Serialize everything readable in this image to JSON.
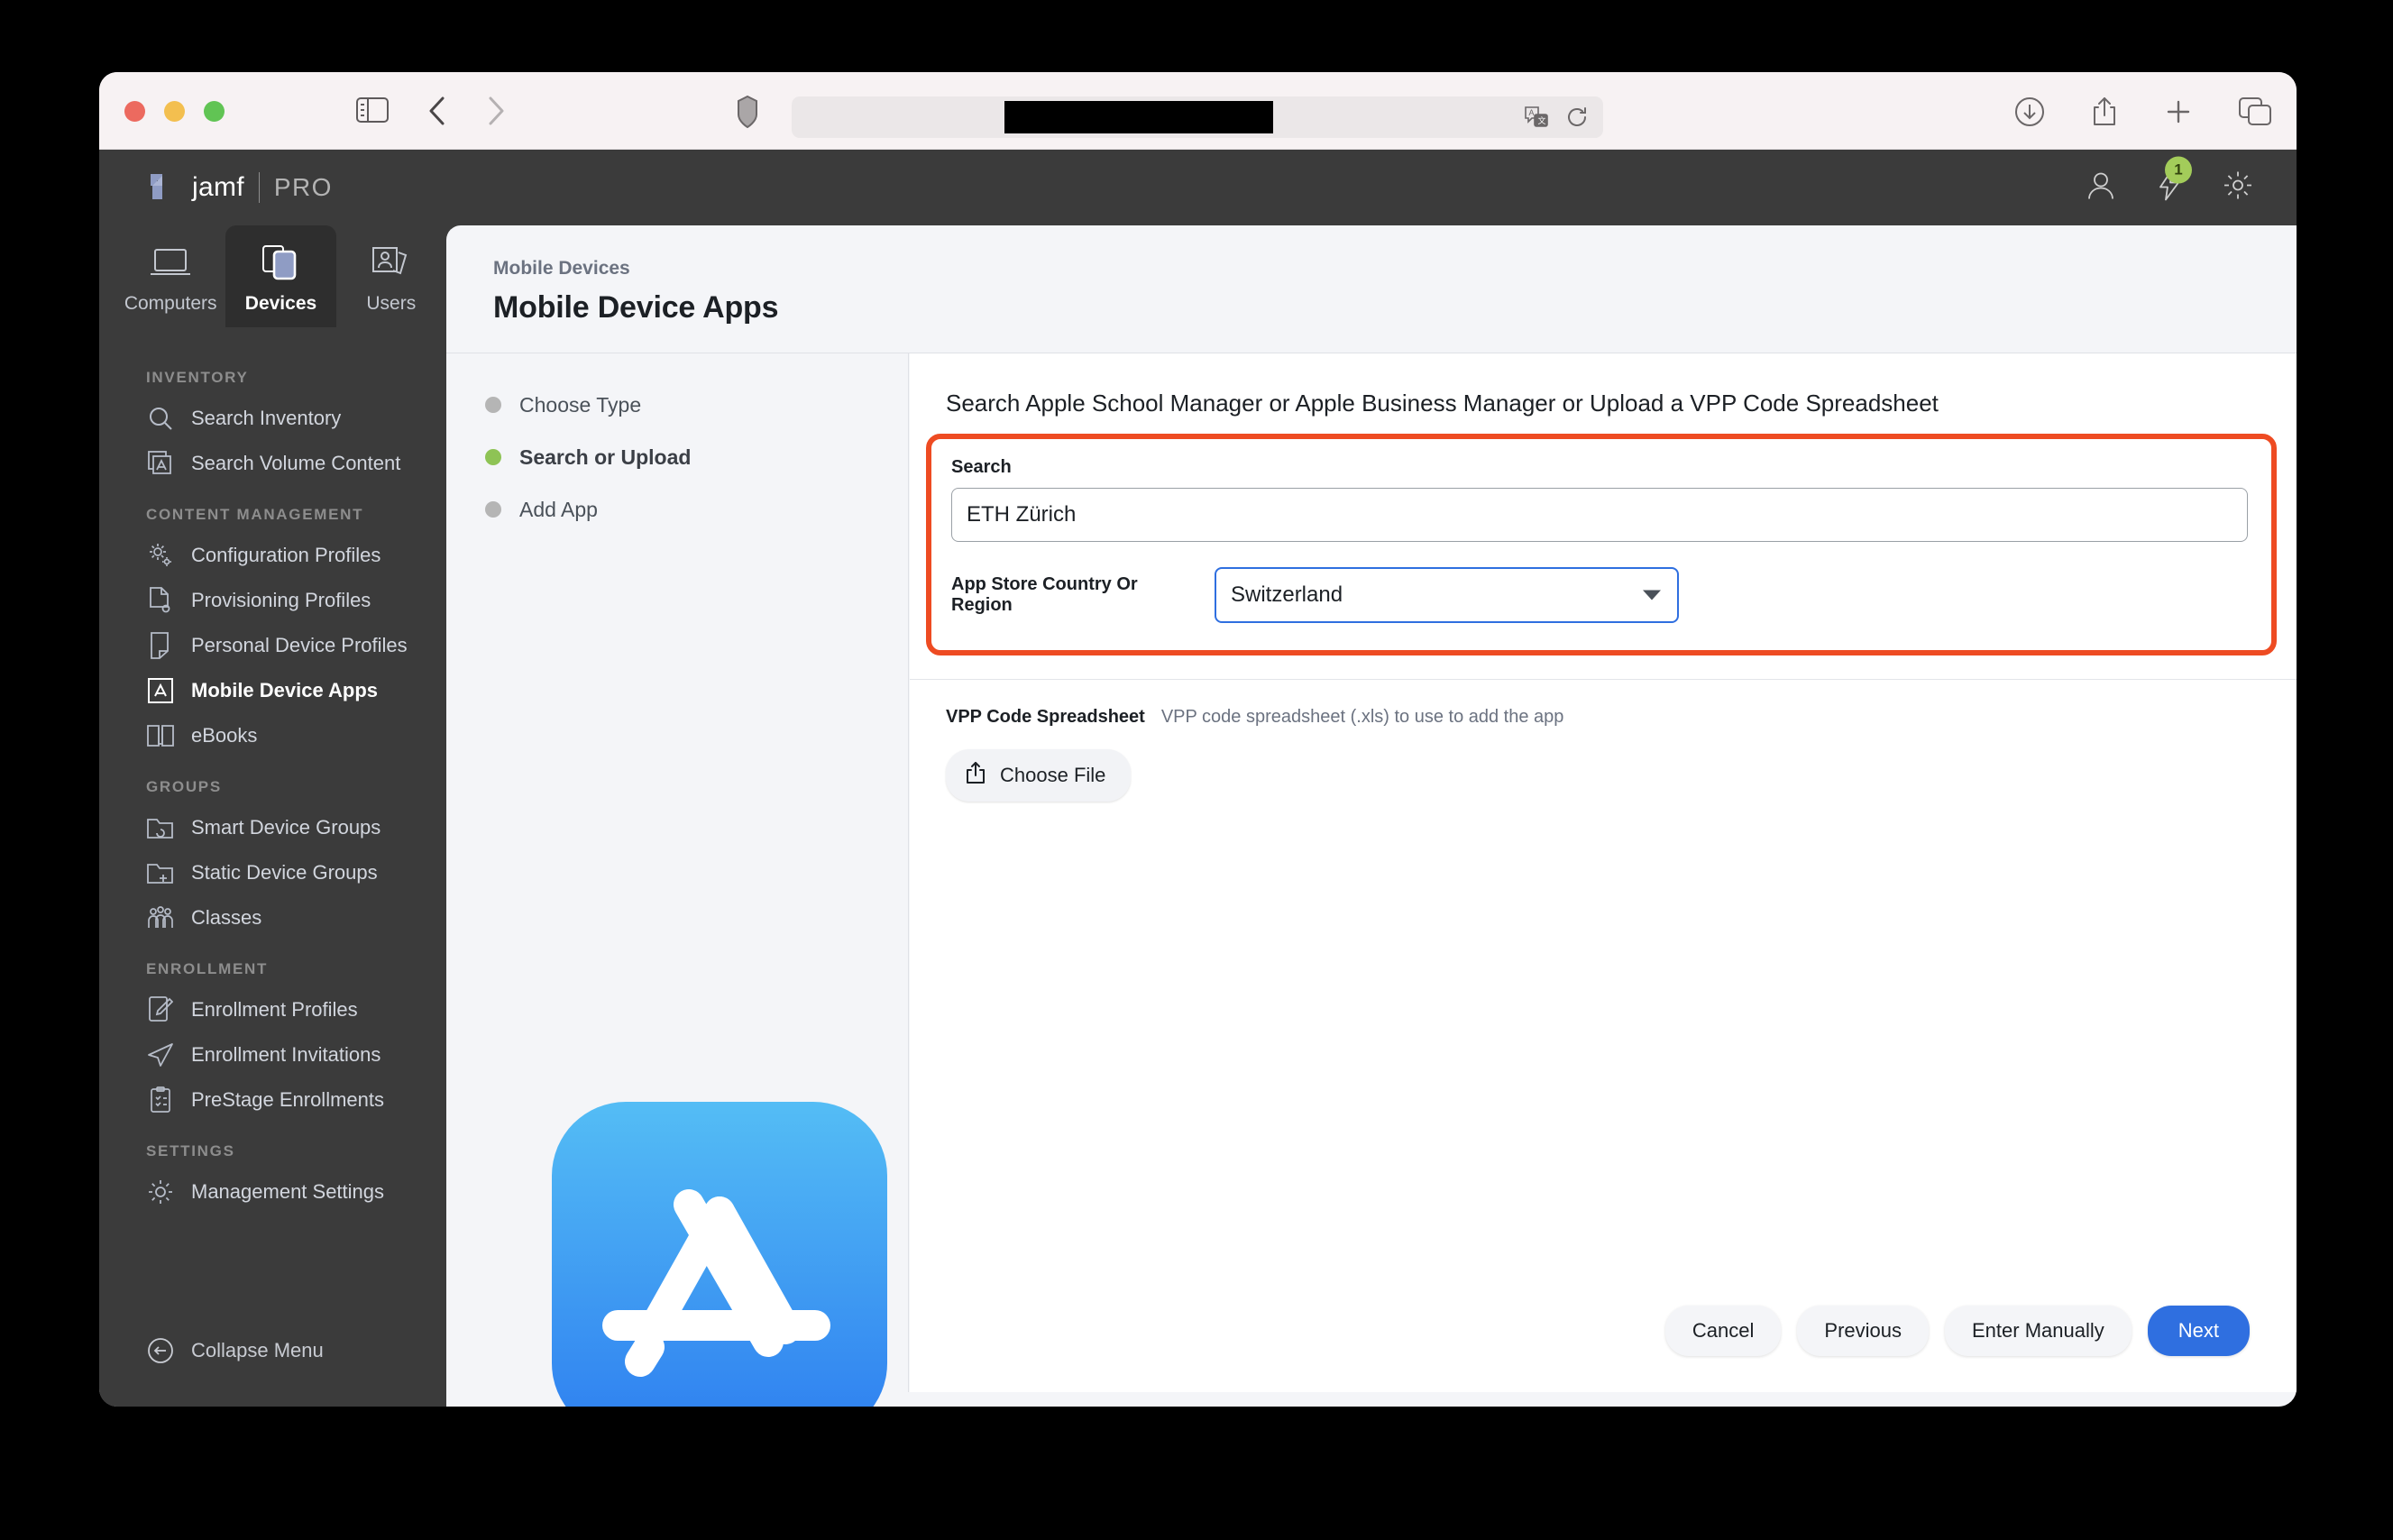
{
  "browser": {
    "traffic_lights": [
      "close",
      "minimize",
      "maximize"
    ],
    "url_value": "",
    "icons": {
      "sidebar": "sidebar-toggle-icon",
      "back": "back-arrow-icon",
      "forward": "forward-arrow-icon",
      "shield": "privacy-shield-icon",
      "translate": "translate-icon",
      "reload": "reload-icon",
      "downloads": "downloads-icon",
      "share": "share-icon",
      "new_tab": "plus-icon",
      "tab_overview": "tab-overview-icon"
    }
  },
  "app_header": {
    "logo_text": "jamf",
    "logo_pro": "PRO",
    "notification_count": "1",
    "icons": {
      "user": "user-icon",
      "notifications": "lightning-bolt-icon",
      "settings": "gear-icon"
    }
  },
  "tabs": [
    {
      "label": "Computers",
      "icon": "laptop-icon",
      "active": false
    },
    {
      "label": "Devices",
      "icon": "mobile-device-icon",
      "active": true
    },
    {
      "label": "Users",
      "icon": "users-icon",
      "active": false
    }
  ],
  "sidebar": {
    "sections": [
      {
        "label": "INVENTORY",
        "items": [
          {
            "label": "Search Inventory",
            "icon": "magnifier-icon",
            "active": false
          },
          {
            "label": "Search Volume Content",
            "icon": "app-store-stack-icon",
            "active": false
          }
        ]
      },
      {
        "label": "CONTENT MANAGEMENT",
        "items": [
          {
            "label": "Configuration Profiles",
            "icon": "gears-icon",
            "active": false
          },
          {
            "label": "Provisioning Profiles",
            "icon": "document-gear-icon",
            "active": false
          },
          {
            "label": "Personal Device Profiles",
            "icon": "personal-device-icon",
            "active": false
          },
          {
            "label": "Mobile Device Apps",
            "icon": "app-store-icon",
            "active": true
          },
          {
            "label": "eBooks",
            "icon": "book-icon",
            "active": false
          }
        ]
      },
      {
        "label": "GROUPS",
        "items": [
          {
            "label": "Smart Device Groups",
            "icon": "folder-sync-icon",
            "active": false
          },
          {
            "label": "Static Device Groups",
            "icon": "folder-plus-icon",
            "active": false
          },
          {
            "label": "Classes",
            "icon": "people-group-icon",
            "active": false
          }
        ]
      },
      {
        "label": "ENROLLMENT",
        "items": [
          {
            "label": "Enrollment Profiles",
            "icon": "device-pencil-icon",
            "active": false
          },
          {
            "label": "Enrollment Invitations",
            "icon": "paper-plane-icon",
            "active": false
          },
          {
            "label": "PreStage Enrollments",
            "icon": "clipboard-check-icon",
            "active": false
          }
        ]
      },
      {
        "label": "SETTINGS",
        "items": [
          {
            "label": "Management Settings",
            "icon": "gear-icon",
            "active": false
          }
        ]
      }
    ],
    "collapse_label": "Collapse Menu",
    "collapse_icon": "arrow-left-circle-icon"
  },
  "page": {
    "breadcrumb": "Mobile Devices",
    "title": "Mobile Device Apps"
  },
  "wizard": {
    "steps": [
      {
        "label": "Choose Type",
        "active": false
      },
      {
        "label": "Search or Upload",
        "active": true
      },
      {
        "label": "Add App",
        "active": false
      }
    ],
    "illustration_icon": "app-store-large-icon"
  },
  "form": {
    "title": "Search Apple School Manager or Apple Business Manager or Upload a VPP Code Spreadsheet",
    "search_label": "Search",
    "search_value": "ETH Zürich",
    "search_placeholder": "",
    "country_label": "App Store Country Or Region",
    "country_value": "Switzerland",
    "vpp_label": "VPP Code Spreadsheet",
    "vpp_hint": "VPP code spreadsheet (.xls) to use to add the app",
    "choose_file_label": "Choose File",
    "choose_file_icon": "upload-icon",
    "highlight_color": "#ee4b22",
    "focus_color": "#2f6fe0"
  },
  "footer": {
    "cancel": "Cancel",
    "previous": "Previous",
    "enter_manually": "Enter Manually",
    "next": "Next"
  }
}
